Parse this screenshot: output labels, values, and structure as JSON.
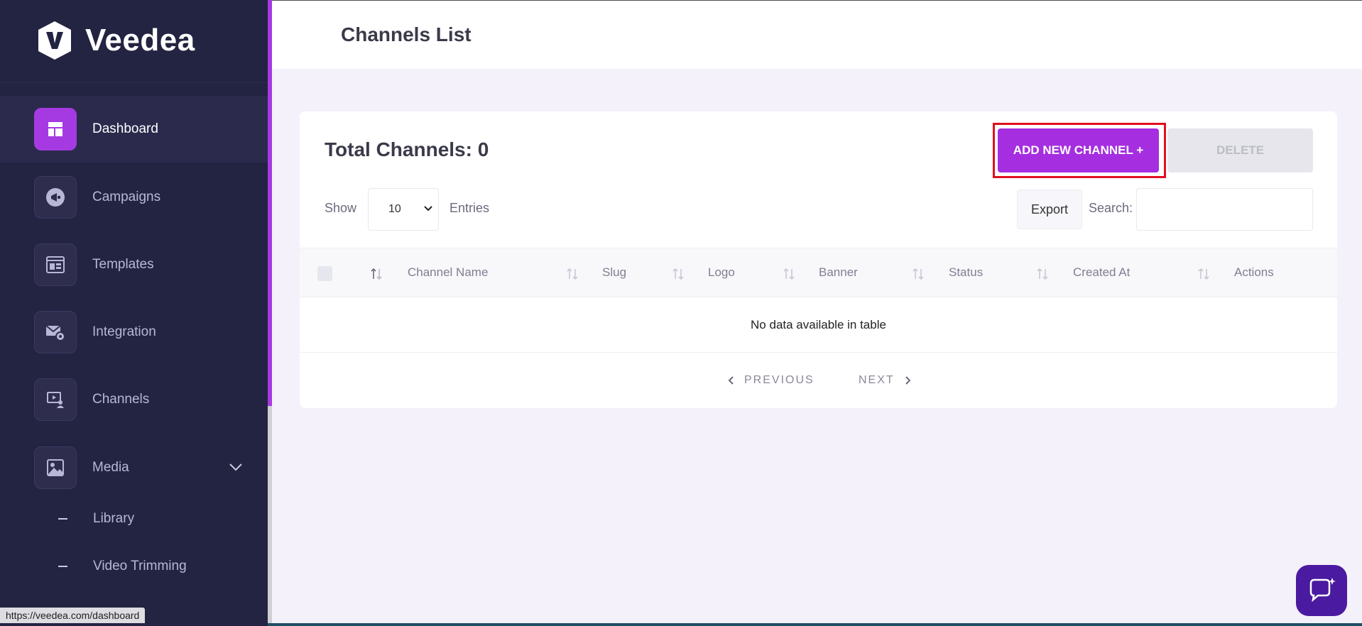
{
  "brand": {
    "name": "Veedea"
  },
  "sidebar": {
    "items": [
      {
        "label": "Dashboard",
        "icon": "dashboard-icon",
        "active": true
      },
      {
        "label": "Campaigns",
        "icon": "megaphone-icon"
      },
      {
        "label": "Templates",
        "icon": "template-icon"
      },
      {
        "label": "Integration",
        "icon": "mail-gear-icon"
      },
      {
        "label": "Channels",
        "icon": "channel-icon"
      },
      {
        "label": "Media",
        "icon": "image-icon",
        "expanded": true
      }
    ],
    "sub_items": [
      {
        "label": "Library"
      },
      {
        "label": "Video Trimming"
      }
    ]
  },
  "header": {
    "title": "Channels List"
  },
  "card": {
    "title": "Total Channels: 0",
    "add_button": "ADD NEW CHANNEL +",
    "delete_button": "DELETE",
    "show_label": "Show",
    "entries_value": "10",
    "entries_label": "Entries",
    "export_button": "Export",
    "search_label": "Search:",
    "columns": [
      "Channel Name",
      "Slug",
      "Logo",
      "Banner",
      "Status",
      "Created At",
      "Actions"
    ],
    "empty_message": "No data available in table",
    "prev_label": "PREVIOUS",
    "next_label": "NEXT"
  },
  "status_bar": {
    "url": "https://veedea.com/dashboard"
  },
  "colors": {
    "accent": "#a52fe0",
    "sidebar_bg": "#232342",
    "highlight": "#e0101e"
  }
}
